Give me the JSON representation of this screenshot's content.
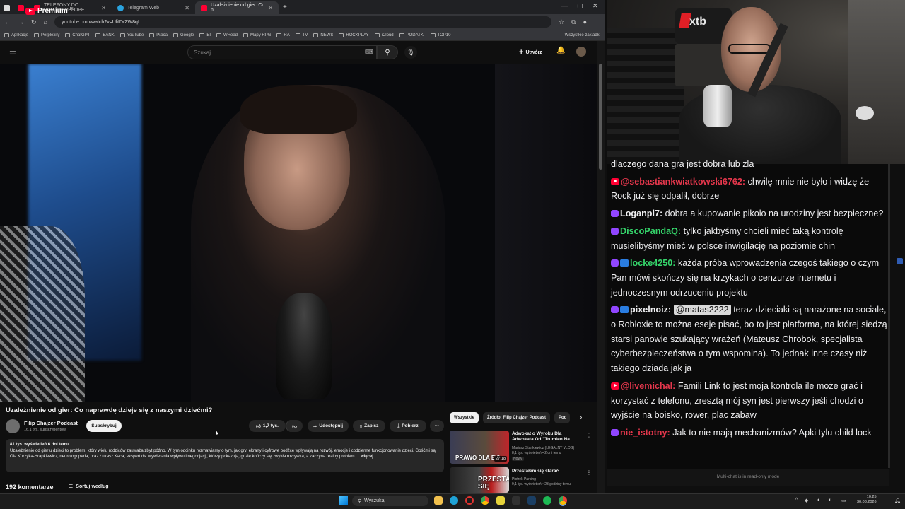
{
  "browser": {
    "tabs": [
      {
        "label": ""
      },
      {
        "label": ""
      },
      {
        "label": "TELEFONY DO PATODEWELOPE"
      },
      {
        "label": "Telegram Web"
      },
      {
        "label": "Uzależnienie od gier: Co n..."
      }
    ],
    "url": "youtube.com/watch?v=UliIDrZW8qI",
    "bookmarks": [
      "Aplikacje",
      "Perplexity",
      "ChatGPT",
      "BANK",
      "YouTube",
      "Praca",
      "Google",
      "EI",
      "WHead",
      "Mapy RPG",
      "RA",
      "TV",
      "NEWS",
      "ROCKPLAY",
      "iCloud",
      "PODATKI",
      "TOP10"
    ],
    "bookmarks_right": "Wszystkie zakładki"
  },
  "youtube": {
    "logo": "Premium",
    "logo_region": "PL",
    "search_placeholder": "Szukaj",
    "create_label": "Utwórz",
    "video_title": "Uzależnienie od gier: Co naprawdę dzieje się z naszymi dziećmi?",
    "channel_name": "Filip Chajzer Podcast",
    "channel_subs": "16,1 tys. subskrybentów",
    "subscribe_label": "Subskrybuj",
    "likes": "1,7 tys.",
    "share_label": "Udostępnij",
    "save_label": "Zapisz",
    "download_label": "Pobierz",
    "desc_meta": "81 tys. wyświetleń  6 dni temu",
    "desc_text": "Uzależnienie od gier u dzieci to problem, który wielu rodziców zauważa zbyt późno. W tym odcinku rozmawiamy o tym, jak gry, ekrany i cyfrowe bodźce wpływają na rozwój, emocje i codzienne funkcjonowanie dzieci. Gośćmi są Ola Kurzyka-Hrapkiewicz, neurologopeda, oraz Łukasz Kaca, ekspert ds. wywierania wpływu i negocjacji, którzy pokazują, gdzie kończy się zwykła rozrywka, a zaczyna realny problem.",
    "desc_more": "...więcej",
    "comments_count": "192 komentarze",
    "sort_label": "Sortuj według",
    "chips": [
      "Wszystkie",
      "Źródło: Filip Chajzer Podcast",
      "Pod"
    ],
    "related": [
      {
        "title": "Adwokat o Wyroku Dla Adwokata Od \"Trumien Na ...",
        "channel": "Mariusz Stankiewicz (LEGALNY VLOG)",
        "meta": "8,1 tys. wyświetleń • 2 dni temu",
        "badge": "Nowy",
        "thumb_text": "PRAWO DLA EI?",
        "duration": "27:18"
      },
      {
        "title": "Przestałem się starać.",
        "channel": "Piotrek Parking",
        "meta": "9,1 tys. wyświetleń • 23 godziny temu",
        "badge": "",
        "thumb_text": "PRZESTAŁEM SIĘ",
        "duration": ""
      }
    ]
  },
  "webcam": {
    "brand_text": "xtb"
  },
  "chat": {
    "messages": [
      {
        "platform": "none",
        "badge": false,
        "user": "",
        "user_color": "#efeff1",
        "mention": "",
        "text": "dlaczego dana gra jest dobra lub zla"
      },
      {
        "platform": "youtube",
        "badge": false,
        "user": "@sebastiankwiatkowski6762:",
        "user_color": "#e5374c",
        "mention": "",
        "text": "chwilę mnie nie było i widzę że Rock już się odpalił, dobrze"
      },
      {
        "platform": "twitch",
        "badge": false,
        "user": "Loganpl7:",
        "user_color": "#efeff1",
        "mention": "",
        "text": "dobra a kupowanie pikolo na urodziny jest bezpieczne?"
      },
      {
        "platform": "twitch",
        "badge": false,
        "user": "DiscoPandaQ:",
        "user_color": "#35d66b",
        "mention": "",
        "text": "tylko jakbyśmy chcieli mieć taką kontrolę musielibyśmy mieć w polsce inwigilację na poziomie chin"
      },
      {
        "platform": "twitch",
        "badge": true,
        "user": "locke4250:",
        "user_color": "#35d66b",
        "mention": "",
        "text": "każda próba wprowadzenia czegoś takiego o czym Pan mówi skończy się na krzykach o cenzurze internetu i jednoczesnym odrzuceniu projektu"
      },
      {
        "platform": "twitch",
        "badge": true,
        "user": "pixelnoiz:",
        "user_color": "#efeff1",
        "mention": "@matas2222",
        "text": "teraz dzieciaki są narażone na sociale, o Robloxie to można eseje pisać, bo to jest platforma, na której siedzą starsi panowie szukający wrażeń (Mateusz Chrobok, specjalista cyberbezpieczeństwa o tym wspomina). To jednak inne czasy niż takiego dziada jak ja"
      },
      {
        "platform": "youtube",
        "badge": false,
        "user": "@livemichal:",
        "user_color": "#e5374c",
        "mention": "",
        "text": "Famili Link to jest moja kontrola ile może grać i korzystać z telefonu, zresztą mój syn jest pierwszy jeśli chodzi o wyjście na boisko, rower, plac zabaw"
      },
      {
        "platform": "twitch",
        "badge": false,
        "user": "nie_istotny:",
        "user_color": "#e5374c",
        "mention": "",
        "text": "Jak to nie mają mechanizmów? Apki tylu child lock"
      }
    ],
    "footer": "Multi-chat is in read-only mode"
  },
  "taskbar": {
    "search_label": "Wyszukaj",
    "time": "10:25",
    "date": "30.03.2026"
  }
}
